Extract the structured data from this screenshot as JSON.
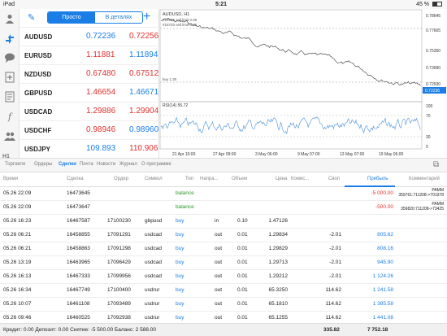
{
  "status_bar": {
    "device": "iPad",
    "time": "5:21",
    "battery": "45 %",
    "battery_level": 0.45
  },
  "left_bar": {
    "icons": [
      "person-icon",
      "quotes-icon",
      "chat-icon",
      "add-document-icon",
      "news-icon",
      "function-icon",
      "group-icon"
    ],
    "label": "H1"
  },
  "quotes": {
    "segments": [
      "Просто",
      "В деталях"
    ],
    "rows": [
      {
        "symbol": "AUDUSD",
        "bid": "0.72236",
        "ask": "0.72256",
        "bid_color": "blue",
        "ask_color": "red"
      },
      {
        "symbol": "EURUSD",
        "bid": "1.11881",
        "ask": "1.11894",
        "bid_color": "red",
        "ask_color": "blue"
      },
      {
        "symbol": "NZDUSD",
        "bid": "0.67480",
        "ask": "0.67512",
        "bid_color": "red",
        "ask_color": "red"
      },
      {
        "symbol": "GBPUSD",
        "bid": "1.46654",
        "ask": "1.46671",
        "bid_color": "red",
        "ask_color": "blue"
      },
      {
        "symbol": "USDCAD",
        "bid": "1.29886",
        "ask": "1.29904",
        "bid_color": "red",
        "ask_color": "red"
      },
      {
        "symbol": "USDCHF",
        "bid": "0.98946",
        "ask": "0.98960",
        "bid_color": "red",
        "ask_color": "blue"
      },
      {
        "symbol": "USDJPY",
        "bid": "109.893",
        "ask": "110.906",
        "bid_color": "blue",
        "ask_color": "red"
      }
    ]
  },
  "chart": {
    "symbol_label": "AUDUSD, H1",
    "annotations": [
      "#16756 sell limit 0.05",
      "#16703 sell limit 0.05",
      "buy 1.30"
    ],
    "price_ticks": [
      "0.78645",
      "0.77605",
      "0.75350",
      "0.73990",
      "0.72930",
      "0.72236"
    ],
    "current_price": "0.72236",
    "indicator_label": "RSI(14) 55.72",
    "rsi_ticks": [
      "100",
      "70",
      "30",
      "0"
    ],
    "time_ticks": [
      "21 Apr 10:00",
      "27 Apr 09:00",
      "3 May 06:00",
      "9 May 07:00",
      "13 May 07:00",
      "19 May 06:00"
    ]
  },
  "bottom_tabs": [
    "Торговля",
    "Ордеры",
    "Сделки",
    "Почта",
    "Новости",
    "Журнал",
    "О программе"
  ],
  "active_tab": "Сделки",
  "table": {
    "headers": [
      "Время",
      "Сделка",
      "Ордер",
      "Символ",
      "Тип",
      "Напра...",
      "Объем",
      "Цена",
      "Комис...",
      "Своп",
      "Прибыль",
      "Комментарий"
    ],
    "sorted_header": "Прибыль",
    "rows": [
      {
        "time": "05.26 22:09",
        "deal": "16473645",
        "order": "",
        "symbol": "",
        "type": "balance",
        "dir": "",
        "volume": "",
        "price": "",
        "commission": "",
        "swap": "",
        "profit": "-5 000.00",
        "profit_color": "red",
        "comment_1": "PAMM",
        "comment_2": "359761:711208->701978"
      },
      {
        "time": "05.26 22:09",
        "deal": "16473647",
        "order": "",
        "symbol": "",
        "type": "balance",
        "dir": "",
        "volume": "",
        "price": "",
        "commission": "",
        "swap": "",
        "profit": "-500.00",
        "profit_color": "red",
        "comment_1": "PAMM",
        "comment_2": "359820:711208->73425"
      },
      {
        "time": "05.26 16:23",
        "deal": "16467587",
        "order": "17100230",
        "symbol": "gbpusd",
        "type": "buy",
        "dir": "in",
        "volume": "0.10",
        "price": "1.47126",
        "commission": "",
        "swap": "",
        "profit": "",
        "profit_color": "blue",
        "comment_1": "",
        "comment_2": ""
      },
      {
        "time": "05.26 06:21",
        "deal": "16458855",
        "order": "17091291",
        "symbol": "usdcad",
        "type": "buy",
        "dir": "out",
        "volume": "0.01",
        "price": "1.29834",
        "commission": "",
        "swap": "-2.01",
        "profit": "805.62",
        "profit_color": "blue",
        "comment_1": "",
        "comment_2": ""
      },
      {
        "time": "05.26 06:21",
        "deal": "16458863",
        "order": "17091298",
        "symbol": "usdcad",
        "type": "buy",
        "dir": "out",
        "volume": "0.01",
        "price": "1.29829",
        "commission": "",
        "swap": "-2.01",
        "profit": "808.16",
        "profit_color": "blue",
        "comment_1": "",
        "comment_2": ""
      },
      {
        "time": "05.26 13:19",
        "deal": "16463965",
        "order": "17096429",
        "symbol": "usdcad",
        "type": "buy",
        "dir": "out",
        "volume": "0.01",
        "price": "1.29713",
        "commission": "",
        "swap": "-2.01",
        "profit": "945.90",
        "profit_color": "blue",
        "comment_1": "",
        "comment_2": ""
      },
      {
        "time": "05.26 16:13",
        "deal": "16467333",
        "order": "17099956",
        "symbol": "usdcad",
        "type": "buy",
        "dir": "out",
        "volume": "0.01",
        "price": "1.29212",
        "commission": "",
        "swap": "-2.01",
        "profit": "1 124.26",
        "profit_color": "blue",
        "comment_1": "",
        "comment_2": ""
      },
      {
        "time": "05.26 16:34",
        "deal": "16467749",
        "order": "17100400",
        "symbol": "usdrur",
        "type": "buy",
        "dir": "out",
        "volume": "0.01",
        "price": "65.3250",
        "commission": "",
        "swap": "114.62",
        "profit": "1 241.58",
        "profit_color": "blue",
        "comment_1": "",
        "comment_2": ""
      },
      {
        "time": "05.26 10:07",
        "deal": "16461108",
        "order": "17093489",
        "symbol": "usdrur",
        "type": "buy",
        "dir": "out",
        "volume": "0.01",
        "price": "65.1810",
        "commission": "",
        "swap": "114.62",
        "profit": "1 385.58",
        "profit_color": "blue",
        "comment_1": "",
        "comment_2": ""
      },
      {
        "time": "05.26 09:46",
        "deal": "16460525",
        "order": "17092938",
        "symbol": "usdrur",
        "type": "buy",
        "dir": "out",
        "volume": "0.01",
        "price": "65.1255",
        "commission": "",
        "swap": "114.62",
        "profit": "1 441.08",
        "profit_color": "blue",
        "comment_1": "",
        "comment_2": ""
      }
    ]
  },
  "footer": {
    "summary": "Кредит: 0.00 Депозит: 0.00 Снятие: -5 500.00 Баланс: 2 588.00",
    "swap_total": "335.82",
    "profit_total": "7 752.18"
  }
}
